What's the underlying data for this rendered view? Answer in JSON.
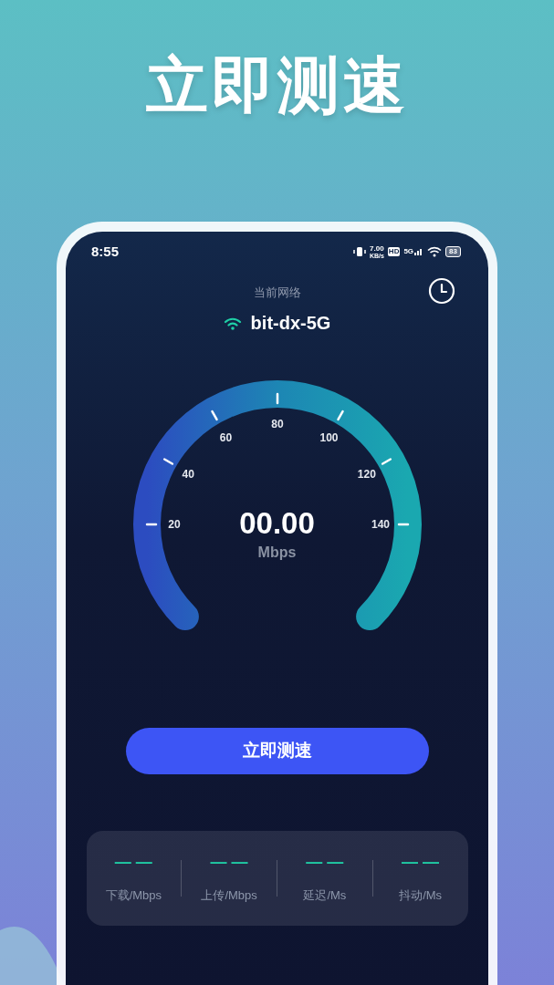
{
  "headline": "立即测速",
  "status_bar": {
    "time": "8:55",
    "net_speed": "7.00",
    "net_speed_unit": "KB/s",
    "hd_badge": "HD",
    "network_type": "5G",
    "battery": "83"
  },
  "network": {
    "label": "当前网络",
    "ssid": "bit-dx-5G"
  },
  "gauge": {
    "ticks": [
      "20",
      "40",
      "60",
      "80",
      "100",
      "120",
      "140"
    ],
    "reading": "00.00",
    "unit": "Mbps"
  },
  "start_button": "立即测速",
  "stats": [
    {
      "value": "— —",
      "label": "下载/Mbps"
    },
    {
      "value": "— —",
      "label": "上传/Mbps"
    },
    {
      "value": "— —",
      "label": "延迟/Ms"
    },
    {
      "value": "— —",
      "label": "抖动/Ms"
    }
  ]
}
